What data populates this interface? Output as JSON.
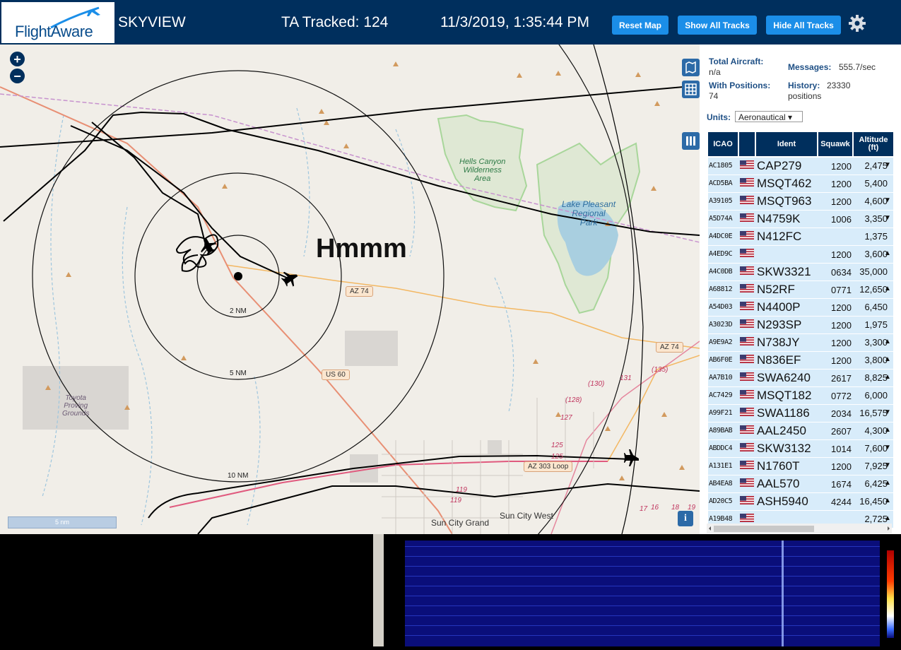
{
  "header": {
    "logo_text": "FlightAware",
    "app_name": "SKYVIEW",
    "tracked": "TA Tracked: 124",
    "clock": "11/3/2019, 1:35:44 PM",
    "buttons": {
      "reset_map": "Reset Map",
      "show_all": "Show All Tracks",
      "hide_all": "Hide All Tracks"
    },
    "settings_icon": "gear-icon"
  },
  "map": {
    "annotation": "Hmmm",
    "rings": [
      "2 NM",
      "5 NM",
      "10 NM"
    ],
    "roads": [
      "AZ 74",
      "AZ 74",
      "US 60",
      "AZ 303 Loop"
    ],
    "route_numbers": [
      "(130)",
      "131",
      "(135)",
      "(128)",
      "127",
      "125",
      "125",
      "119",
      "119",
      "17",
      "16",
      "18",
      "19"
    ],
    "places": [
      "Sun City Grand",
      "Sun City West"
    ],
    "parks": [
      "Hells Canyon\nWilderness\nArea",
      "Lake Pleasant\nRegional\nPark"
    ],
    "proving_grounds": "Toyota\nProving\nGrounds",
    "scale": "5 nm",
    "info": "i",
    "zoom_in": "+",
    "zoom_out": "−"
  },
  "sidebar": {
    "total_aircraft_label": "Total Aircraft:",
    "total_aircraft_value": "n/a",
    "messages_label": "Messages:",
    "messages_value": "555.7/sec",
    "with_positions_label": "With Positions:",
    "with_positions_value": "74",
    "history_label": "History:",
    "history_value": "23330",
    "history_unit": "positions",
    "units_label": "Units:",
    "units_value": "Aeronautical ▾",
    "columns": [
      "ICAO",
      "Ident",
      "Squawk",
      "Altitude\n(ft)"
    ],
    "rows": [
      {
        "icao": "AC1805",
        "ident": "CAP279",
        "squawk": "1200",
        "alt": "2,475",
        "trend": "▼"
      },
      {
        "icao": "ACD5BA",
        "ident": "MSQT462",
        "squawk": "1200",
        "alt": "5,400",
        "trend": ""
      },
      {
        "icao": "A39105",
        "ident": "MSQT963",
        "squawk": "1200",
        "alt": "4,600",
        "trend": "▼"
      },
      {
        "icao": "A5D74A",
        "ident": "N4759K",
        "squawk": "1006",
        "alt": "3,350",
        "trend": "▼"
      },
      {
        "icao": "A4DC0E",
        "ident": "N412FC",
        "squawk": "",
        "alt": "1,375",
        "trend": ""
      },
      {
        "icao": "A4ED9C",
        "ident": "",
        "squawk": "1200",
        "alt": "3,600",
        "trend": "▲"
      },
      {
        "icao": "A4C0DB",
        "ident": "SKW3321",
        "squawk": "0634",
        "alt": "35,000",
        "trend": ""
      },
      {
        "icao": "A68812",
        "ident": "N52RF",
        "squawk": "0771",
        "alt": "12,650",
        "trend": "▲"
      },
      {
        "icao": "A54D03",
        "ident": "N4400P",
        "squawk": "1200",
        "alt": "6,450",
        "trend": ""
      },
      {
        "icao": "A3023D",
        "ident": "N293SP",
        "squawk": "1200",
        "alt": "1,975",
        "trend": ""
      },
      {
        "icao": "A9E9A2",
        "ident": "N738JY",
        "squawk": "1200",
        "alt": "3,300",
        "trend": "▲"
      },
      {
        "icao": "AB6F0E",
        "ident": "N836EF",
        "squawk": "1200",
        "alt": "3,800",
        "trend": "▲"
      },
      {
        "icao": "AA7B10",
        "ident": "SWA6240",
        "squawk": "2617",
        "alt": "8,825",
        "trend": "▲"
      },
      {
        "icao": "AC7429",
        "ident": "MSQT182",
        "squawk": "0772",
        "alt": "6,000",
        "trend": ""
      },
      {
        "icao": "A99F21",
        "ident": "SWA1186",
        "squawk": "2034",
        "alt": "16,575",
        "trend": "▼"
      },
      {
        "icao": "A89BAB",
        "ident": "AAL2450",
        "squawk": "2607",
        "alt": "4,300",
        "trend": "▲"
      },
      {
        "icao": "ABDDC4",
        "ident": "SKW3132",
        "squawk": "1014",
        "alt": "7,600",
        "trend": "▼"
      },
      {
        "icao": "A131E1",
        "ident": "N1760T",
        "squawk": "1200",
        "alt": "7,925",
        "trend": "▼"
      },
      {
        "icao": "AB4EA8",
        "ident": "AAL570",
        "squawk": "1674",
        "alt": "6,425",
        "trend": "▲"
      },
      {
        "icao": "AD20C5",
        "ident": "ASH5940",
        "squawk": "4244",
        "alt": "16,450",
        "trend": "▲"
      },
      {
        "icao": "A19B48",
        "ident": "",
        "squawk": "",
        "alt": "2,725",
        "trend": "▲"
      }
    ]
  }
}
